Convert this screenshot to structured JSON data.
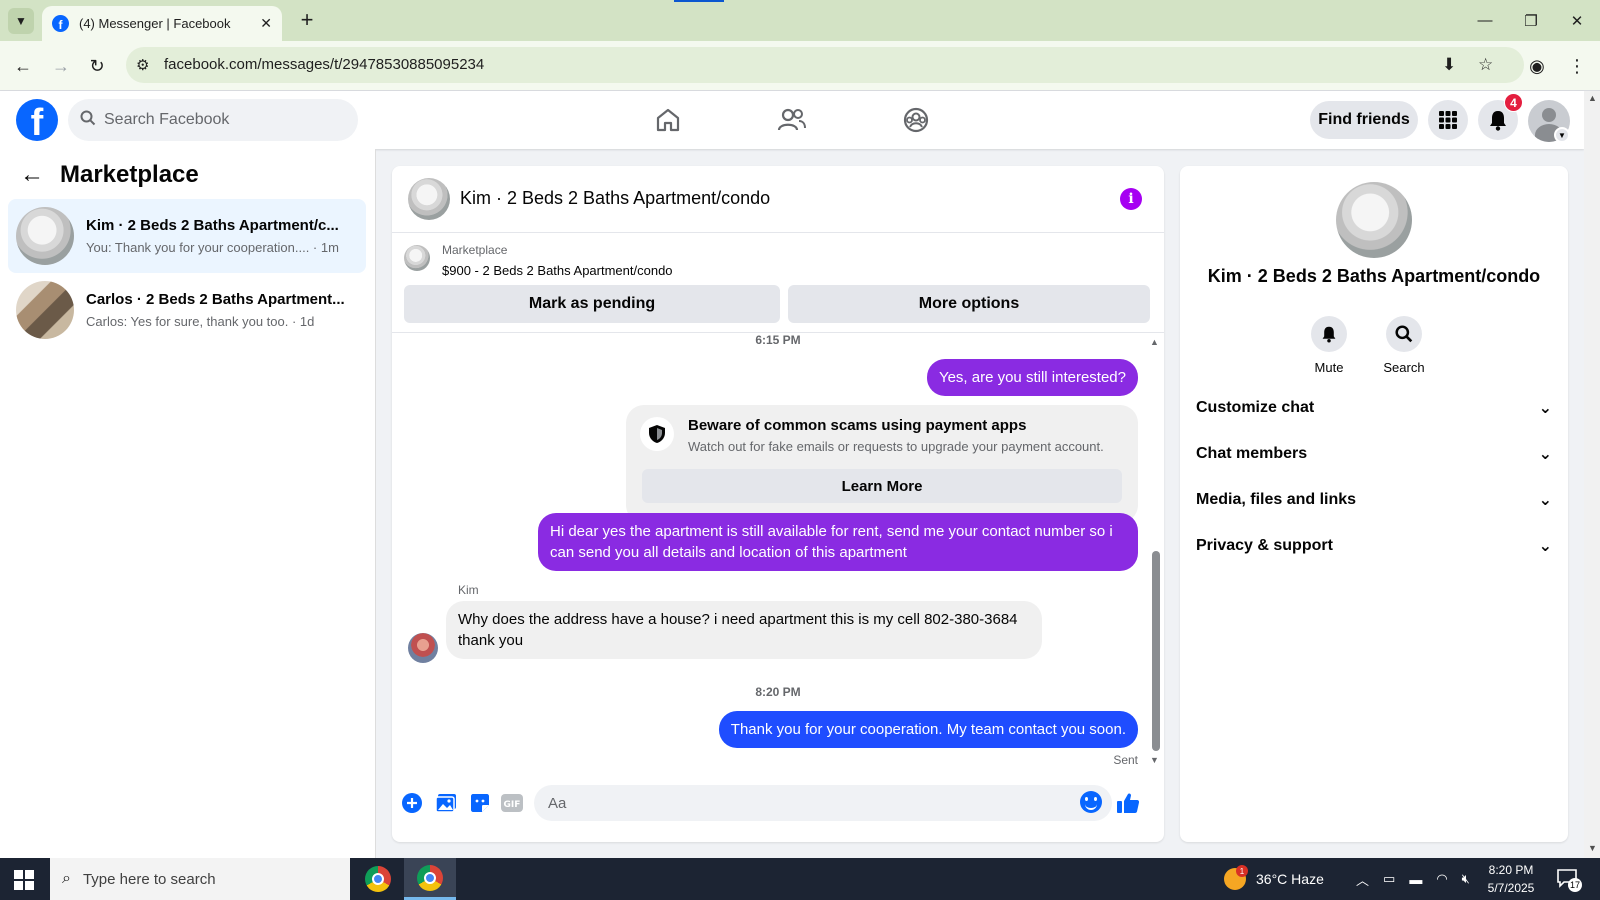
{
  "browser": {
    "tab_title": "(4) Messenger | Facebook",
    "tab_close": "✕",
    "new_tab": "+",
    "url": "facebook.com/messages/t/29478530885095234",
    "window_controls": [
      "—",
      "❐",
      "✕"
    ]
  },
  "header": {
    "search_placeholder": "Search Facebook",
    "find_friends_label": "Find friends",
    "notification_count": "4"
  },
  "left_panel": {
    "title": "Marketplace",
    "chats": [
      {
        "name": "Kim · 2 Beds 2 Baths Apartment/c...",
        "preview": "You: Thank you for your cooperation.... · 1m",
        "active": true
      },
      {
        "name": "Carlos · 2 Beds 2 Baths Apartment...",
        "preview": "Carlos: Yes for sure, thank you too. · 1d",
        "active": false
      }
    ]
  },
  "conversation": {
    "title": "Kim · 2 Beds 2 Baths Apartment/condo",
    "marketplace_label": "Marketplace",
    "listing": "$900 - 2 Beds 2 Baths Apartment/condo",
    "mark_pending_label": "Mark as pending",
    "more_options_label": "More options",
    "messages": {
      "time1": "6:15 PM",
      "out1": "Yes, are you still interested?",
      "scam_title": "Beware of common scams using payment apps",
      "scam_body": "Watch out for fake emails or requests to upgrade your payment account.",
      "learn_more": "Learn More",
      "out2": "Hi dear yes the apartment is still available for rent, send me your contact number so i can send you all details and location of this apartment",
      "sender": "Kim",
      "in1": "Why does the address have a house? i need apartment this is my cell 802-380-3684 thank you",
      "time2": "8:20 PM",
      "out3": "Thank you for your cooperation. My team contact you soon.",
      "status": "Sent"
    },
    "composer_placeholder": "Aa"
  },
  "right_panel": {
    "name": "Kim · 2 Beds 2 Baths Apartment/condo",
    "mute_label": "Mute",
    "search_label": "Search",
    "sections": [
      "Customize chat",
      "Chat members",
      "Media, files and links",
      "Privacy & support"
    ]
  },
  "taskbar": {
    "search_text": "Type here to search",
    "weather": "36°C  Haze",
    "weather_badge": "1",
    "time": "8:20 PM",
    "date": "5/7/2025",
    "notification_count": "17"
  },
  "colors": {
    "facebook_blue": "#0866ff",
    "messenger_purple": "#8a2be2",
    "info_purple": "#a600f2",
    "badge_red": "#e41e3f"
  }
}
